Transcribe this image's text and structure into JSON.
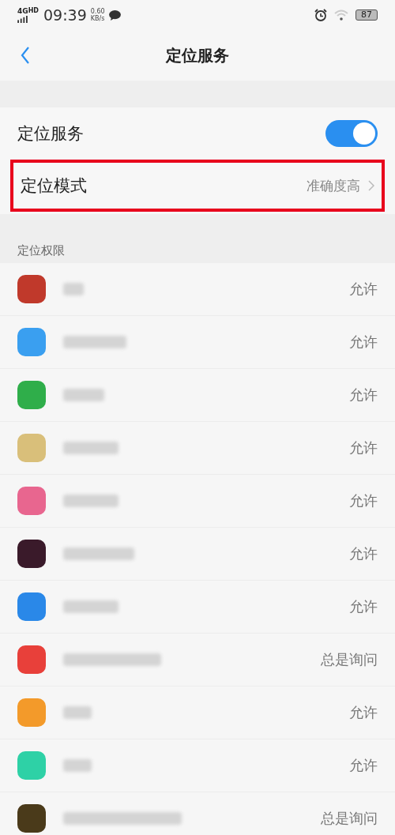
{
  "status_bar": {
    "network": "4G",
    "network_sup": "HD",
    "time": "09:39",
    "speed_value": "0.60",
    "speed_unit": "KB/s",
    "battery": "87"
  },
  "header": {
    "title": "定位服务"
  },
  "location_toggle": {
    "label": "定位服务",
    "on": true
  },
  "location_mode": {
    "label": "定位模式",
    "value": "准确度高",
    "highlighted": true
  },
  "permissions": {
    "heading": "定位权限",
    "apps": [
      {
        "status": "允许",
        "color": "#c0392b"
      },
      {
        "status": "允许",
        "color": "#3a9ff0"
      },
      {
        "status": "允许",
        "color": "#2fae4a"
      },
      {
        "status": "允许",
        "color": "#d9bf7a"
      },
      {
        "status": "允许",
        "color": "#e8668f"
      },
      {
        "status": "允许",
        "color": "#3a1a2a"
      },
      {
        "status": "允许",
        "color": "#2a88e8"
      },
      {
        "status": "总是询问",
        "color": "#e8403a"
      },
      {
        "status": "允许",
        "color": "#f39a2a"
      },
      {
        "status": "允许",
        "color": "#2ed1a6"
      },
      {
        "status": "总是询问",
        "color": "#4a3a1a"
      }
    ]
  }
}
